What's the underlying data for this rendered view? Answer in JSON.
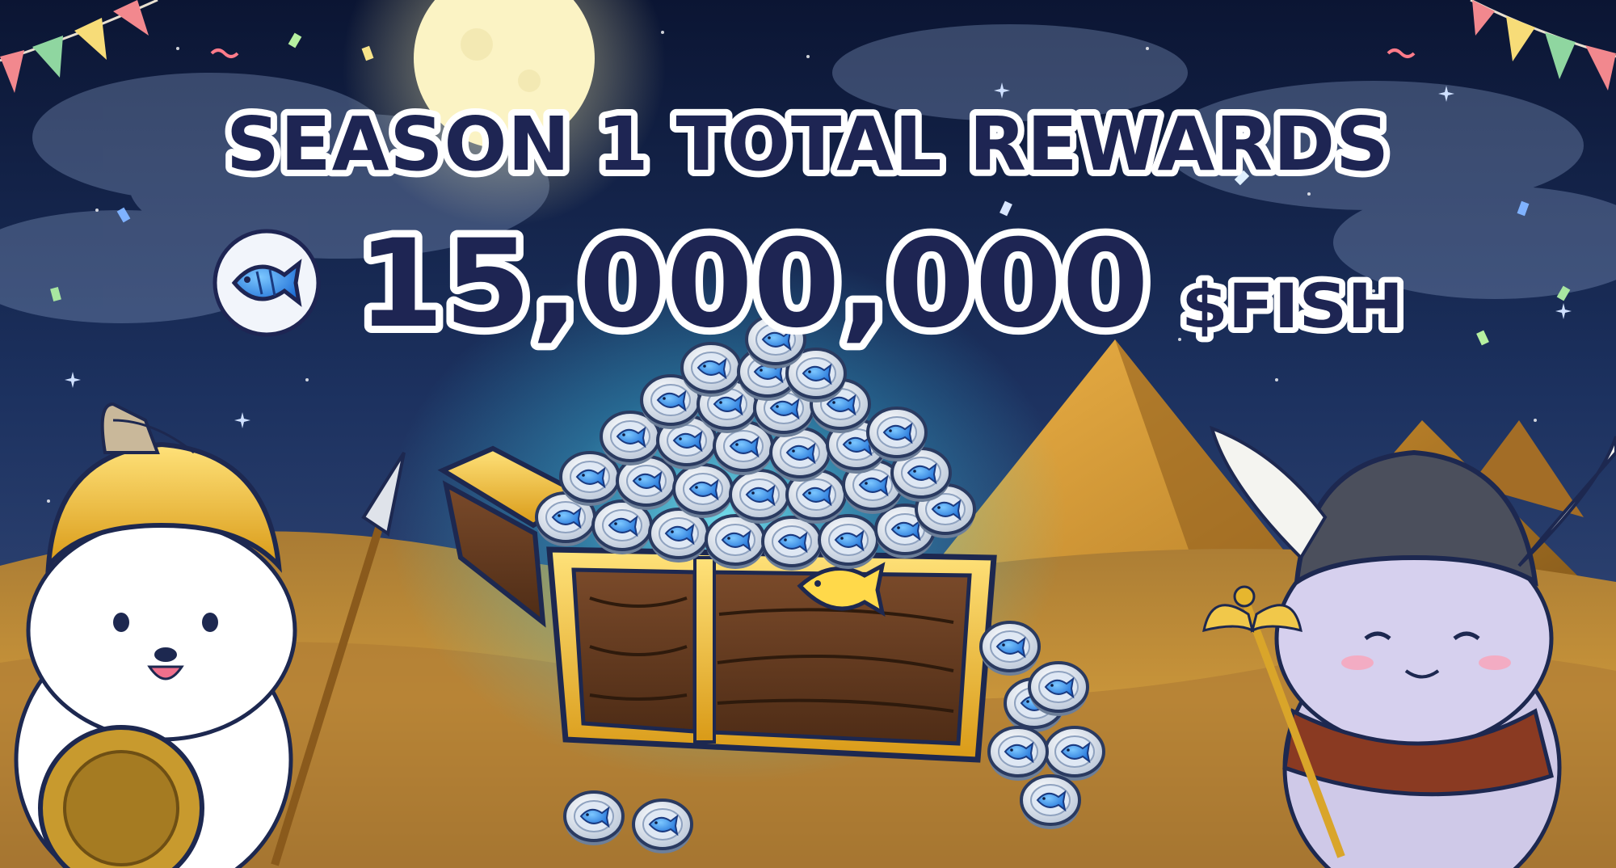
{
  "banner": {
    "title": "SEASON 1 TOTAL REWARDS",
    "amount": "15,000,000",
    "currency": "$FISH",
    "token_icon": "fish-token-icon"
  },
  "scene": {
    "background": "night-desert-sky",
    "elements": [
      "moon",
      "pyramids",
      "treasure-chest",
      "fish-coins",
      "knight-cat-character",
      "viking-cat-character",
      "bunting-flags",
      "confetti"
    ]
  },
  "colors": {
    "title_fill": "#1e2553",
    "title_stroke": "#ffffff",
    "sky_top": "#0b1533",
    "sky_mid": "#1e3466",
    "sand": "#c9953a",
    "chest_gold": "#f2c230",
    "coin_blue": "#2f8ee8",
    "glow": "#5ff0ff"
  }
}
